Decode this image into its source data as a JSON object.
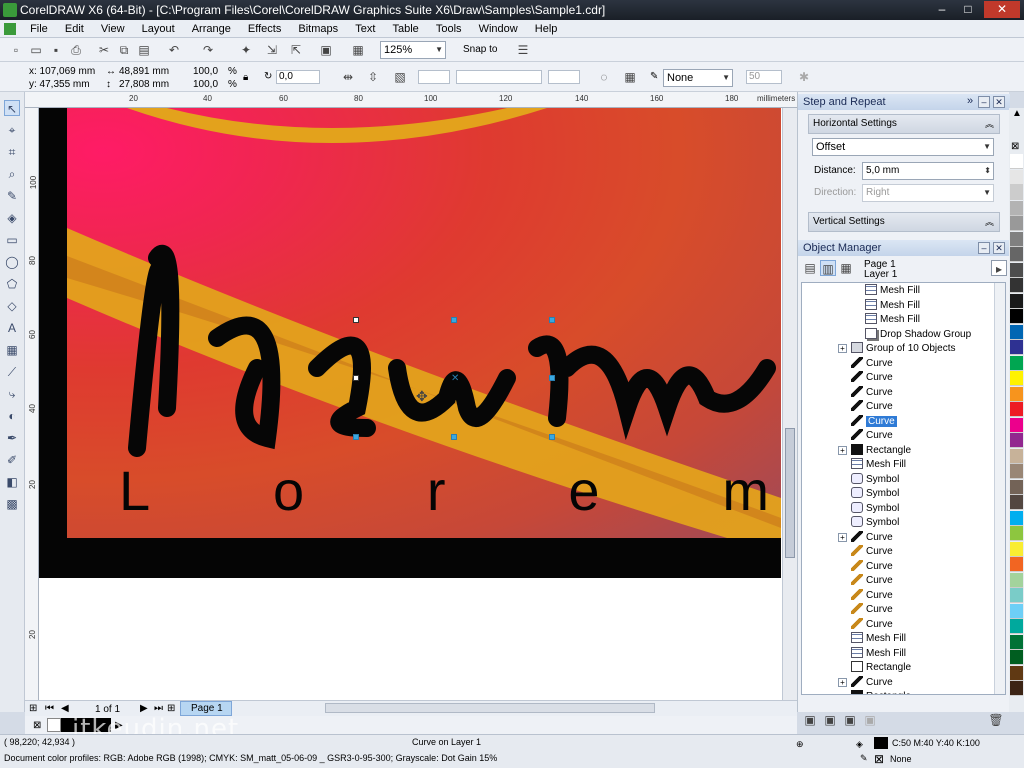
{
  "window": {
    "title": "CorelDRAW X6 (64-Bit) - [C:\\Program Files\\Corel\\CorelDRAW Graphics Suite X6\\Draw\\Samples\\Sample1.cdr]"
  },
  "menu": [
    "File",
    "Edit",
    "View",
    "Layout",
    "Arrange",
    "Effects",
    "Bitmaps",
    "Text",
    "Table",
    "Tools",
    "Window",
    "Help"
  ],
  "standard_toolbar": {
    "zoom": "125%",
    "snap_to": "Snap to"
  },
  "property_bar": {
    "x": "x: 107,069 mm",
    "y": "y: 47,355 mm",
    "width": "48,891 mm",
    "height": "27,808 mm",
    "scale_x": "100,0",
    "scale_y": "100,0",
    "pct": "%",
    "angle": "0,0",
    "outline": "None",
    "outline_width": "50"
  },
  "ruler": {
    "unit": "millimeters",
    "h_ticks": [
      "20",
      "40",
      "60",
      "80",
      "100",
      "120",
      "140",
      "160",
      "180"
    ],
    "v_ticks": [
      "100",
      "80",
      "60",
      "40",
      "20",
      "20"
    ]
  },
  "artwork": {
    "script_word": "Ipsum",
    "lorem_letters": [
      "L",
      "o",
      "r",
      "e",
      "m"
    ]
  },
  "page_nav": {
    "count": "1 of 1",
    "page_tab": "Page 1"
  },
  "docker": {
    "step_repeat": {
      "title": "Step and Repeat",
      "horizontal": "Horizontal Settings",
      "mode": "Offset",
      "distance_label": "Distance:",
      "distance": "5,0 mm",
      "direction_label": "Direction:",
      "direction": "Right",
      "vertical": "Vertical Settings"
    },
    "object_manager": {
      "title": "Object Manager",
      "page": "Page 1",
      "layer": "Layer 1",
      "rows": [
        {
          "label": "Mesh Fill",
          "indent": 2,
          "icon": "mesh"
        },
        {
          "label": "Mesh Fill",
          "indent": 2,
          "icon": "mesh"
        },
        {
          "label": "Mesh Fill",
          "indent": 2,
          "icon": "mesh"
        },
        {
          "label": "Drop Shadow Group",
          "indent": 2,
          "icon": "shadow"
        },
        {
          "label": "Group of 10 Objects",
          "indent": 1,
          "icon": "grp",
          "exp": "+"
        },
        {
          "label": "Curve",
          "indent": 1,
          "icon": "curve"
        },
        {
          "label": "Curve",
          "indent": 1,
          "icon": "curve"
        },
        {
          "label": "Curve",
          "indent": 1,
          "icon": "curve"
        },
        {
          "label": "Curve",
          "indent": 1,
          "icon": "curve"
        },
        {
          "label": "Curve",
          "indent": 1,
          "icon": "curve",
          "selected": true
        },
        {
          "label": "Curve",
          "indent": 1,
          "icon": "curve"
        },
        {
          "label": "Rectangle",
          "indent": 1,
          "icon": "rect",
          "exp": "+"
        },
        {
          "label": "Mesh Fill",
          "indent": 1,
          "icon": "mesh"
        },
        {
          "label": "Symbol",
          "indent": 1,
          "icon": "sym"
        },
        {
          "label": "Symbol",
          "indent": 1,
          "icon": "sym"
        },
        {
          "label": "Symbol",
          "indent": 1,
          "icon": "sym"
        },
        {
          "label": "Symbol",
          "indent": 1,
          "icon": "sym"
        },
        {
          "label": "Curve",
          "indent": 1,
          "icon": "curve",
          "exp": "+"
        },
        {
          "label": "Curve",
          "indent": 1,
          "icon": "curve gold"
        },
        {
          "label": "Curve",
          "indent": 1,
          "icon": "curve gold"
        },
        {
          "label": "Curve",
          "indent": 1,
          "icon": "curve gold"
        },
        {
          "label": "Curve",
          "indent": 1,
          "icon": "curve gold"
        },
        {
          "label": "Curve",
          "indent": 1,
          "icon": "curve gold"
        },
        {
          "label": "Curve",
          "indent": 1,
          "icon": "curve gold"
        },
        {
          "label": "Mesh Fill",
          "indent": 1,
          "icon": "mesh"
        },
        {
          "label": "Mesh Fill",
          "indent": 1,
          "icon": "mesh"
        },
        {
          "label": "Rectangle",
          "indent": 1,
          "icon": "recto"
        },
        {
          "label": "Curve",
          "indent": 1,
          "icon": "curve",
          "exp": "+"
        },
        {
          "label": "Rectangle",
          "indent": 1,
          "icon": "rect"
        }
      ]
    }
  },
  "palette": [
    "#ffffff",
    "#e6e6e6",
    "#cccccc",
    "#b3b3b3",
    "#999999",
    "#808080",
    "#666666",
    "#4d4d4d",
    "#333333",
    "#1a1a1a",
    "#000000",
    "#0066b3",
    "#2e3192",
    "#00a651",
    "#fff200",
    "#f7941d",
    "#ed1c24",
    "#ec008c",
    "#92278f",
    "#c7b299",
    "#998675",
    "#736357",
    "#534741",
    "#00aeef",
    "#8dc63f",
    "#f9ed32",
    "#f26522",
    "#a3d39c",
    "#7accc8",
    "#6dcff6",
    "#00a99d",
    "#007236",
    "#005e20",
    "#603913",
    "#3c2415"
  ],
  "status": {
    "coords": "( 98,220; 42,934 )",
    "object_info": "Curve on Layer 1",
    "profiles": "Document color profiles: RGB: Adobe RGB (1998); CMYK: SM_matt_05-06-09 _ GSR3-0-95-300; Grayscale: Dot Gain 15%",
    "fill": "C:50 M:40 Y:40 K:100",
    "outline": "None"
  },
  "watermark": "itkeudin.net"
}
